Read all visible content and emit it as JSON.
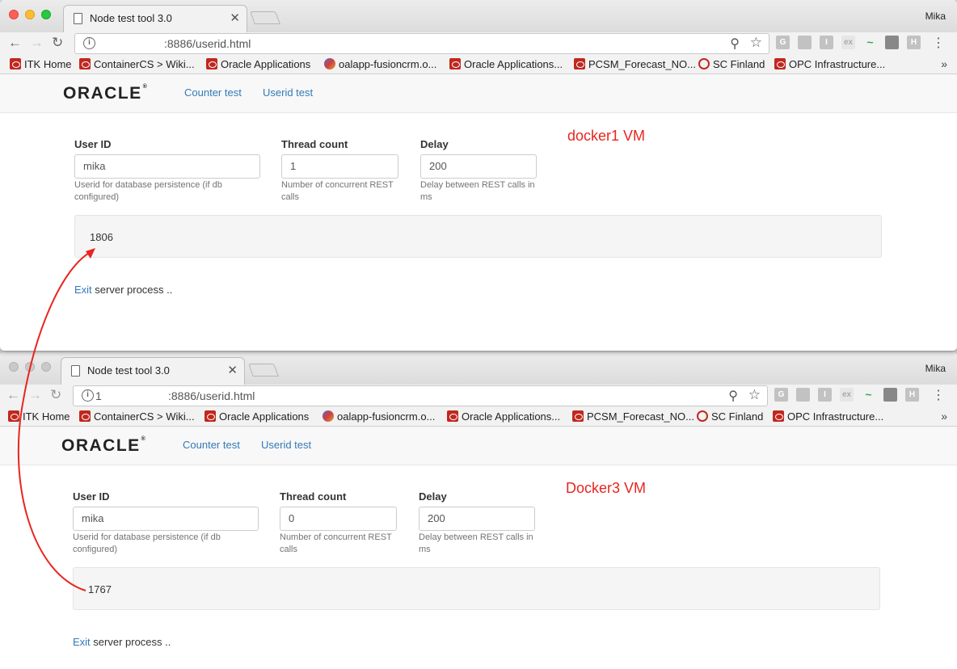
{
  "windows": [
    {
      "tab_title": "Node test tool 3.0",
      "user": "Mika",
      "url_prefix": "",
      "url": ":8886/userid.html",
      "nav": {
        "brand": "ORACLE",
        "links": [
          "Counter test",
          "Userid test"
        ]
      },
      "form": {
        "userid_label": "User ID",
        "userid_value": "mika",
        "userid_help": "Userid for database persistence (if db configured)",
        "threads_label": "Thread count",
        "threads_value": "1",
        "threads_help": "Number of concurrent REST calls",
        "delay_label": "Delay",
        "delay_value": "200",
        "delay_help": "Delay between REST calls in ms"
      },
      "vm_label": "docker1 VM",
      "result": "1806",
      "exit_link": "Exit",
      "exit_text": " server process .."
    },
    {
      "tab_title": "Node test tool 3.0",
      "user": "Mika",
      "url_prefix": "1",
      "url": ":8886/userid.html",
      "nav": {
        "brand": "ORACLE",
        "links": [
          "Counter test",
          "Userid test"
        ]
      },
      "form": {
        "userid_label": "User ID",
        "userid_value": "mika",
        "userid_help": "Userid for database persistence (if db configured)",
        "threads_label": "Thread count",
        "threads_value": "0",
        "threads_help": "Number of concurrent REST calls",
        "delay_label": "Delay",
        "delay_value": "200",
        "delay_help": "Delay between REST calls in ms"
      },
      "vm_label": "Docker3 VM",
      "result": "1767",
      "exit_link": "Exit",
      "exit_text": " server process .."
    }
  ],
  "bookmarks": [
    {
      "label": "ITK Home",
      "icon": "oracle-icon"
    },
    {
      "label": "ContainerCS > Wiki...",
      "icon": "wiki-icon"
    },
    {
      "label": "Oracle Applications",
      "icon": "oracle-icon"
    },
    {
      "label": "oalapp-fusioncrm.o...",
      "icon": "cube-icon"
    },
    {
      "label": "Oracle Applications...",
      "icon": "oracle-icon"
    },
    {
      "label": "PCSM_Forecast_NO...",
      "icon": "oracle-icon"
    },
    {
      "label": "SC Finland",
      "icon": "sc-icon"
    },
    {
      "label": "OPC Infrastructure...",
      "icon": "oracle-icon"
    }
  ],
  "extensions": [
    "G",
    "",
    "I",
    "ex",
    "~",
    "",
    "H"
  ],
  "colors": {
    "annotation": "#e8251f",
    "link": "#337ab7"
  }
}
